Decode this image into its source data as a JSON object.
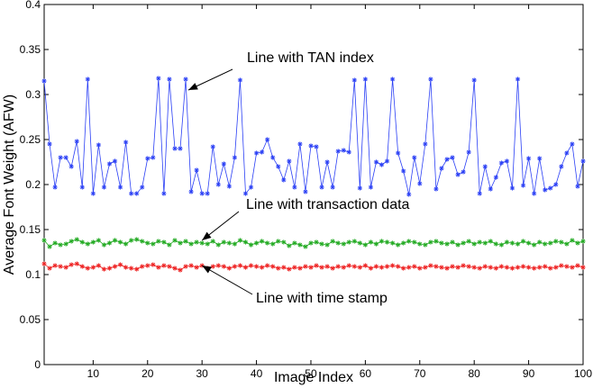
{
  "chart_data": {
    "type": "line",
    "xlabel": "Image Index",
    "ylabel": "Average Font Weight (AFW)",
    "xlim": [
      1,
      100
    ],
    "ylim": [
      0,
      0.4
    ],
    "xticks": [
      10,
      20,
      30,
      40,
      50,
      60,
      70,
      80,
      90,
      100
    ],
    "yticks": [
      0,
      0.05,
      0.1,
      0.15,
      0.2,
      0.25,
      0.3,
      0.35,
      0.4
    ],
    "grid": false,
    "marker": "asterisk",
    "series": [
      {
        "color": "#2a3ff5",
        "x": [
          1,
          2,
          3,
          4,
          5,
          6,
          7,
          8,
          9,
          10,
          11,
          12,
          13,
          14,
          15,
          16,
          17,
          18,
          19,
          20,
          21,
          22,
          23,
          24,
          25,
          26,
          27,
          28,
          29,
          30,
          31,
          32,
          33,
          34,
          35,
          36,
          37,
          38,
          39,
          40,
          41,
          42,
          43,
          44,
          45,
          46,
          47,
          48,
          49,
          50,
          51,
          52,
          53,
          54,
          55,
          56,
          57,
          58,
          59,
          60,
          61,
          62,
          63,
          64,
          65,
          66,
          67,
          68,
          69,
          70,
          71,
          72,
          73,
          74,
          75,
          76,
          77,
          78,
          79,
          80,
          81,
          82,
          83,
          84,
          85,
          86,
          87,
          88,
          89,
          90,
          91,
          92,
          93,
          94,
          95,
          96,
          97,
          98,
          99,
          100
        ],
        "y": [
          0.315,
          0.245,
          0.197,
          0.23,
          0.23,
          0.22,
          0.248,
          0.197,
          0.317,
          0.19,
          0.244,
          0.197,
          0.223,
          0.226,
          0.197,
          0.247,
          0.19,
          0.19,
          0.197,
          0.229,
          0.23,
          0.318,
          0.19,
          0.317,
          0.24,
          0.24,
          0.317,
          0.192,
          0.216,
          0.19,
          0.19,
          0.242,
          0.2,
          0.223,
          0.198,
          0.23,
          0.316,
          0.19,
          0.197,
          0.235,
          0.236,
          0.25,
          0.23,
          0.22,
          0.205,
          0.226,
          0.197,
          0.245,
          0.192,
          0.243,
          0.242,
          0.197,
          0.225,
          0.197,
          0.237,
          0.238,
          0.236,
          0.316,
          0.196,
          0.317,
          0.197,
          0.225,
          0.222,
          0.226,
          0.317,
          0.235,
          0.215,
          0.189,
          0.23,
          0.201,
          0.245,
          0.317,
          0.195,
          0.218,
          0.228,
          0.23,
          0.211,
          0.214,
          0.236,
          0.316,
          0.19,
          0.22,
          0.195,
          0.208,
          0.224,
          0.226,
          0.196,
          0.317,
          0.199,
          0.229,
          0.19,
          0.229,
          0.194,
          0.196,
          0.2,
          0.22,
          0.235,
          0.245,
          0.198,
          0.226
        ]
      },
      {
        "color": "#22aa22",
        "x": [
          1,
          2,
          3,
          4,
          5,
          6,
          7,
          8,
          9,
          10,
          11,
          12,
          13,
          14,
          15,
          16,
          17,
          18,
          19,
          20,
          21,
          22,
          23,
          24,
          25,
          26,
          27,
          28,
          29,
          30,
          31,
          32,
          33,
          34,
          35,
          36,
          37,
          38,
          39,
          40,
          41,
          42,
          43,
          44,
          45,
          46,
          47,
          48,
          49,
          50,
          51,
          52,
          53,
          54,
          55,
          56,
          57,
          58,
          59,
          60,
          61,
          62,
          63,
          64,
          65,
          66,
          67,
          68,
          69,
          70,
          71,
          72,
          73,
          74,
          75,
          76,
          77,
          78,
          79,
          80,
          81,
          82,
          83,
          84,
          85,
          86,
          87,
          88,
          89,
          90,
          91,
          92,
          93,
          94,
          95,
          96,
          97,
          98,
          99,
          100
        ],
        "y": [
          0.138,
          0.131,
          0.135,
          0.133,
          0.134,
          0.137,
          0.139,
          0.136,
          0.134,
          0.136,
          0.138,
          0.133,
          0.135,
          0.138,
          0.136,
          0.134,
          0.138,
          0.139,
          0.137,
          0.135,
          0.134,
          0.137,
          0.136,
          0.133,
          0.138,
          0.135,
          0.137,
          0.134,
          0.136,
          0.135,
          0.134,
          0.137,
          0.133,
          0.136,
          0.135,
          0.134,
          0.138,
          0.136,
          0.133,
          0.135,
          0.137,
          0.135,
          0.134,
          0.137,
          0.136,
          0.132,
          0.135,
          0.133,
          0.131,
          0.135,
          0.136,
          0.134,
          0.133,
          0.137,
          0.135,
          0.134,
          0.136,
          0.137,
          0.135,
          0.133,
          0.136,
          0.134,
          0.137,
          0.136,
          0.135,
          0.133,
          0.135,
          0.137,
          0.136,
          0.134,
          0.133,
          0.136,
          0.137,
          0.135,
          0.134,
          0.136,
          0.133,
          0.135,
          0.137,
          0.134,
          0.136,
          0.135,
          0.137,
          0.134,
          0.133,
          0.136,
          0.135,
          0.134,
          0.137,
          0.135,
          0.133,
          0.136,
          0.134,
          0.135,
          0.137,
          0.136,
          0.134,
          0.138,
          0.135,
          0.137
        ]
      },
      {
        "color": "#ee2222",
        "x": [
          1,
          2,
          3,
          4,
          5,
          6,
          7,
          8,
          9,
          10,
          11,
          12,
          13,
          14,
          15,
          16,
          17,
          18,
          19,
          20,
          21,
          22,
          23,
          24,
          25,
          26,
          27,
          28,
          29,
          30,
          31,
          32,
          33,
          34,
          35,
          36,
          37,
          38,
          39,
          40,
          41,
          42,
          43,
          44,
          45,
          46,
          47,
          48,
          49,
          50,
          51,
          52,
          53,
          54,
          55,
          56,
          57,
          58,
          59,
          60,
          61,
          62,
          63,
          64,
          65,
          66,
          67,
          68,
          69,
          70,
          71,
          72,
          73,
          74,
          75,
          76,
          77,
          78,
          79,
          80,
          81,
          82,
          83,
          84,
          85,
          86,
          87,
          88,
          89,
          90,
          91,
          92,
          93,
          94,
          95,
          96,
          97,
          98,
          99,
          100
        ],
        "y": [
          0.112,
          0.107,
          0.11,
          0.109,
          0.108,
          0.111,
          0.112,
          0.109,
          0.107,
          0.108,
          0.11,
          0.106,
          0.107,
          0.109,
          0.111,
          0.108,
          0.107,
          0.106,
          0.109,
          0.11,
          0.111,
          0.108,
          0.11,
          0.109,
          0.107,
          0.105,
          0.109,
          0.11,
          0.108,
          0.11,
          0.107,
          0.109,
          0.11,
          0.109,
          0.107,
          0.109,
          0.11,
          0.108,
          0.11,
          0.109,
          0.108,
          0.11,
          0.109,
          0.107,
          0.108,
          0.106,
          0.108,
          0.107,
          0.109,
          0.108,
          0.11,
          0.108,
          0.109,
          0.107,
          0.109,
          0.108,
          0.11,
          0.109,
          0.108,
          0.11,
          0.107,
          0.109,
          0.108,
          0.109,
          0.11,
          0.109,
          0.107,
          0.108,
          0.109,
          0.107,
          0.108,
          0.11,
          0.109,
          0.108,
          0.107,
          0.109,
          0.108,
          0.11,
          0.109,
          0.108,
          0.107,
          0.109,
          0.108,
          0.107,
          0.109,
          0.108,
          0.107,
          0.108,
          0.109,
          0.108,
          0.107,
          0.108,
          0.109,
          0.107,
          0.108,
          0.11,
          0.109,
          0.108,
          0.11,
          0.108
        ]
      }
    ],
    "annotations": [
      {
        "text": "Line with TAN index",
        "arrow_to": [
          27.5,
          0.305
        ]
      },
      {
        "text": "Line with transaction data",
        "arrow_to": [
          30,
          0.138
        ]
      },
      {
        "text": "Line with time stamp",
        "arrow_to": [
          30,
          0.11
        ]
      }
    ]
  }
}
